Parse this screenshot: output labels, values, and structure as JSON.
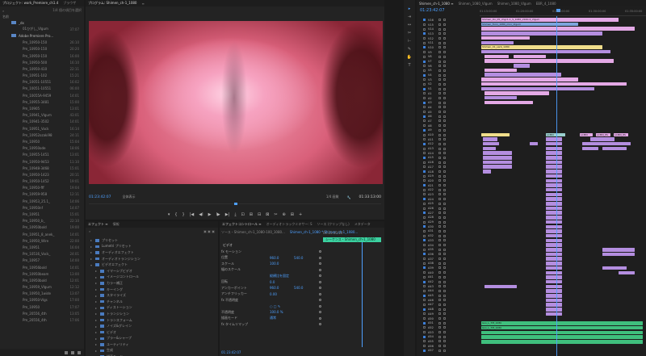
{
  "project": {
    "tabs": [
      "プロジェクト: work_Premiere_ch1.4",
      "ブラウザ"
    ],
    "search_placeholder": "",
    "item_count": "1/4 個の項目を選択",
    "name_header": "名前",
    "items": [
      {
        "name": "_dx",
        "dur": "",
        "folder": true
      },
      {
        "name": "01ひがし_Vlgum",
        "dur": "37:07"
      },
      {
        "name": "Adobe Premiere Pro...",
        "dur": "",
        "folder": true
      },
      {
        "name": "Pm_10950-150",
        "dur": "26:10"
      },
      {
        "name": "Pm_10950-150",
        "dur": "20:20"
      },
      {
        "name": "Pm_10950-150",
        "dur": "16:00"
      },
      {
        "name": "Pm_10950-500",
        "dur": "16:10"
      },
      {
        "name": "Pm_10950-410",
        "dur": "22:11"
      },
      {
        "name": "Pm_10951-102",
        "dur": "15:21"
      },
      {
        "name": "Pm_10051-10551",
        "dur": "16:02"
      },
      {
        "name": "Pm_10051-10551",
        "dur": "06:00"
      },
      {
        "name": "Pm_10055A-9459",
        "dur": "14:01"
      },
      {
        "name": "Pm_10955-3481",
        "dur": "15:00"
      },
      {
        "name": "Pm_10905",
        "dur": "13:01"
      },
      {
        "name": "Pm_10941_Vlgum",
        "dur": "43:01"
      },
      {
        "name": "Pm_10941-3502",
        "dur": "14:01"
      },
      {
        "name": "Pm_10951_Vock",
        "dur": "16:14"
      },
      {
        "name": "Pm_10952ozaki98",
        "dur": "24:11"
      },
      {
        "name": "Pm_10950",
        "dur": "15:04"
      },
      {
        "name": "Pm_10950ode",
        "dur": "18:06"
      },
      {
        "name": "Pm_10955-1451",
        "dur": "13:01"
      },
      {
        "name": "Pm_10950-9453",
        "dur": "11:10"
      },
      {
        "name": "Pm_10948-3468",
        "dur": "15:01"
      },
      {
        "name": "Pm_10950-1423",
        "dur": "20:11"
      },
      {
        "name": "Pm_10950-1452",
        "dur": "19:01"
      },
      {
        "name": "Pm_10950-fff",
        "dur": "19:04"
      },
      {
        "name": "Pm_10959-958",
        "dur": "12:11"
      },
      {
        "name": "Pm_10953_25.1_",
        "dur": "14:06"
      },
      {
        "name": "Pm_10950nf",
        "dur": "14:07"
      },
      {
        "name": "Pm_10951",
        "dur": "15:01"
      },
      {
        "name": "Pm_10950_b_",
        "dur": "22:10"
      },
      {
        "name": "Pm_10950bold",
        "dur": "19:00"
      },
      {
        "name": "Pm_10951_8_anek_",
        "dur": "14:01"
      },
      {
        "name": "Pm_10950_Wire",
        "dur": "22:00"
      },
      {
        "name": "Pm_10951",
        "dur": "16:04"
      },
      {
        "name": "Pm_10516_Vock_",
        "dur": "24:01"
      },
      {
        "name": "Pm_10957",
        "dur": "14:00"
      },
      {
        "name": "Pm_10956bold",
        "dur": "14:01"
      },
      {
        "name": "Pm_10950beam",
        "dur": "13:00"
      },
      {
        "name": "Pm_10950bold",
        "dur": "12:01"
      },
      {
        "name": "Pm_10959_Vlgum",
        "dur": "12:12"
      },
      {
        "name": "Pm_10950_1wide",
        "dur": "13:07"
      },
      {
        "name": "Pm_10950-Vlgs",
        "dur": "17:00"
      },
      {
        "name": "Pm_10950",
        "dur": "17:07"
      },
      {
        "name": "Pm_20556_4th",
        "dur": "13:05"
      },
      {
        "name": "Pm_20556_4th",
        "dur": "17:06"
      }
    ]
  },
  "program": {
    "tabs": [
      "プログラム: Shimen_ch-1_1080",
      "≡"
    ],
    "timecode_current": "01:23:42:07",
    "fit_label": "全体表示",
    "quality": "1/4 画質",
    "timecode_duration": "01:33:13:00",
    "transport": [
      "▾",
      "{",
      "}",
      "|◀",
      "◀I",
      "▶",
      "I▶",
      "▶|",
      "⤓",
      "⊡",
      "⊞",
      "⊟",
      "⊠",
      "✂",
      "⊕",
      "⊞",
      "+"
    ]
  },
  "effects": {
    "tabs": [
      "エフェクト ≡",
      "情報"
    ],
    "items": [
      {
        "name": "プリセット",
        "type": "folder"
      },
      {
        "name": "Lumetri プリセット",
        "type": "folder"
      },
      {
        "name": "オーディオエフェクト",
        "type": "folder"
      },
      {
        "name": "オーディオトランジション",
        "type": "folder"
      },
      {
        "name": "ビデオエフェクト",
        "type": "folder-open"
      },
      {
        "name": "イマーシブビデオ",
        "type": "folder"
      },
      {
        "name": "イメージコントロール",
        "type": "folder"
      },
      {
        "name": "カラー補正",
        "type": "folder"
      },
      {
        "name": "キーイング",
        "type": "folder"
      },
      {
        "name": "スタイライズ",
        "type": "folder"
      },
      {
        "name": "チャンネル",
        "type": "folder"
      },
      {
        "name": "ディストーション",
        "type": "folder"
      },
      {
        "name": "トランジション",
        "type": "folder"
      },
      {
        "name": "トランスフォーム",
        "type": "folder"
      },
      {
        "name": "ノイズ&グレイン",
        "type": "folder"
      },
      {
        "name": "ビデオ",
        "type": "folder"
      },
      {
        "name": "ブラー&シャープ",
        "type": "folder"
      },
      {
        "name": "ユーティリティ",
        "type": "folder"
      },
      {
        "name": "生成",
        "type": "folder"
      },
      {
        "name": "描画モード",
        "type": "folder"
      },
      {
        "name": "遠近",
        "type": "folder"
      }
    ]
  },
  "effect_controls": {
    "tabs": [
      "エフェクトコントロール ≡",
      "オーディオトラックミキサー: S",
      "ソース (クリップなし)",
      "メタデータ"
    ],
    "source_label": "ソース・Shimen_ch-1_1080-100_1080...",
    "sequence_label": "Shimen_ch-1_1080 * Shimen_ch-1_1080...",
    "clip_tc": "01:23:30:10",
    "clip_name": "シーケンス・Shimen_ch-1_1080",
    "section": "ビデオ",
    "rows": [
      {
        "label": "fx モーション",
        "v": "",
        "v2": ""
      },
      {
        "label": "位置",
        "v": "960.0",
        "v2": "540.0"
      },
      {
        "label": "スケール",
        "v": "100.0",
        "v2": ""
      },
      {
        "label": "幅のスケール",
        "v": "",
        "v2": ""
      },
      {
        "label": "",
        "v": "縦横比を固定",
        "v2": ""
      },
      {
        "label": "回転",
        "v": "0.0",
        "v2": ""
      },
      {
        "label": "アンカーポイント",
        "v": "960.0",
        "v2": "540.0"
      },
      {
        "label": "アンチフリッカー",
        "v": "0.00",
        "v2": ""
      },
      {
        "label": "fx 不透明度",
        "v": "",
        "v2": ""
      },
      {
        "label": "",
        "v": "○ □ ✎",
        "v2": ""
      },
      {
        "label": "不透明度",
        "v": "100.0 %",
        "v2": ""
      },
      {
        "label": "描画モード",
        "v": "通常",
        "v2": ""
      },
      {
        "label": "fx タイムリマップ",
        "v": "",
        "v2": ""
      }
    ],
    "footer_tc": "01:23:42:07"
  },
  "tools": [
    "▸",
    "⇥",
    "↔",
    "✂",
    "⊢",
    "✎",
    "✋",
    "T"
  ],
  "timeline": {
    "tabs": [
      "Shimen_ch-1_1080 ≡",
      "Shimen_1080_Vlgum",
      "Shimen_1080_Vlgum",
      "EBR_4_1080"
    ],
    "timecode": "01:23:42:07",
    "ruler_labels": [
      "01:15:00:00",
      "01:20:00:00",
      "01:25:00:00",
      "01:30:00:00",
      "01:35:00:00"
    ],
    "tracks": [
      "V16",
      "V15",
      "V14",
      "V13",
      "V12",
      "V11",
      "V10",
      "V9",
      "V8",
      "V7",
      "V6",
      "V5",
      "V4",
      "V3",
      "V2",
      "V1",
      "A1",
      "A2",
      "A3",
      "A4",
      "A5",
      "A6",
      "A7",
      "A8",
      "A9",
      "A10",
      "A11",
      "A12",
      "A13",
      "A14",
      "A15",
      "A16",
      "A17",
      "A18",
      "A19",
      "A20",
      "A21",
      "A22",
      "A23",
      "A24",
      "A25",
      "A26",
      "A27",
      "A28",
      "A29",
      "A30",
      "A31",
      "A32",
      "A33",
      "A34",
      "A35",
      "A36",
      "A37",
      "A38",
      "A39",
      "A40",
      "A41",
      "A42",
      "A43",
      "A44",
      "A45",
      "A46",
      "A47",
      "A48",
      "A49",
      "A50",
      "A51",
      "A52",
      "A53",
      "A54",
      "A55",
      "A56",
      "A57",
      "A58",
      "A59",
      "A60",
      "A61",
      "A62",
      "A63",
      "A64"
    ],
    "clip_labels": {
      "top1": "Shimen_Oo_05_chgc1.1_S_1080_2160.4_Vlgum",
      "top2": "Shimen_Tomi_1080_mini_Vlgum",
      "top3": "Shimen_01_sarb_1080",
      "mid1": "LCMN",
      "mid2": "LCMN_8S",
      "bot1": "Gov_L_TM_1080"
    }
  },
  "colors": {
    "accent": "#4ea0ff",
    "pink": "#e4a9e6",
    "violet": "#b48ee0",
    "green": "#3fbf7d",
    "yellow": "#f0dd8a",
    "teal_clip": "#3bd1a0"
  }
}
